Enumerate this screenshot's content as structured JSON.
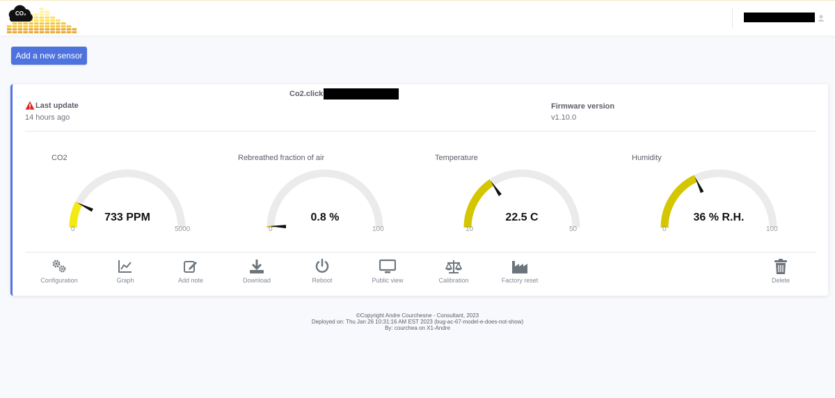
{
  "header": {
    "logo_text": "CO₂",
    "user_name_redacted": true
  },
  "toolbar": {
    "add_sensor_label": "Add a new sensor"
  },
  "sensor": {
    "title": "Co2.click",
    "last_update_label": "Last update",
    "last_update_value": "14 hours ago",
    "firmware_label": "Firmware version",
    "firmware_value": "v1.10.0"
  },
  "gauges": [
    {
      "title": "CO2",
      "value": 733,
      "min": 0,
      "max": 5000,
      "display": "733 PPM",
      "min_label": "0",
      "max_label": "5000",
      "color": "#f2ea10"
    },
    {
      "title": "Rebreathed fraction of air",
      "value": 0.8,
      "min": 0,
      "max": 100,
      "display": "0.8 %",
      "min_label": "0",
      "max_label": "100",
      "color": "#d4c600"
    },
    {
      "title": "Temperature",
      "value": 22.5,
      "min": 10,
      "max": 50,
      "display": "22.5 C",
      "min_label": "10",
      "max_label": "50",
      "color": "#d4c600"
    },
    {
      "title": "Humidity",
      "value": 36,
      "min": 0,
      "max": 100,
      "display": "36 % R.H.",
      "min_label": "0",
      "max_label": "100",
      "color": "#d4c600"
    }
  ],
  "actions": [
    {
      "label": "Configuration",
      "icon": "gears-icon"
    },
    {
      "label": "Graph",
      "icon": "chart-line-icon"
    },
    {
      "label": "Add note",
      "icon": "edit-icon"
    },
    {
      "label": "Download",
      "icon": "download-icon"
    },
    {
      "label": "Reboot",
      "icon": "power-icon"
    },
    {
      "label": "Public view",
      "icon": "monitor-icon"
    },
    {
      "label": "Calibration",
      "icon": "balance-scale-icon"
    },
    {
      "label": "Factory reset",
      "icon": "industry-icon"
    },
    {
      "label": "Delete",
      "icon": "trash-icon"
    }
  ],
  "footer": {
    "line1": "©Copyright Andre Courchesne - Consultant, 2023",
    "line2": "Deployed on: Thu Jan 26 10:31:16 AM EST 2023 (bug-ac-67-model-e-does-not-show)",
    "line3": "By: courchea on X1-Andre"
  },
  "colors": {
    "primary": "#4e73df",
    "gauge_track": "#ebebeb",
    "gauge_fill": "#d4c600",
    "warning": "#e02424"
  }
}
